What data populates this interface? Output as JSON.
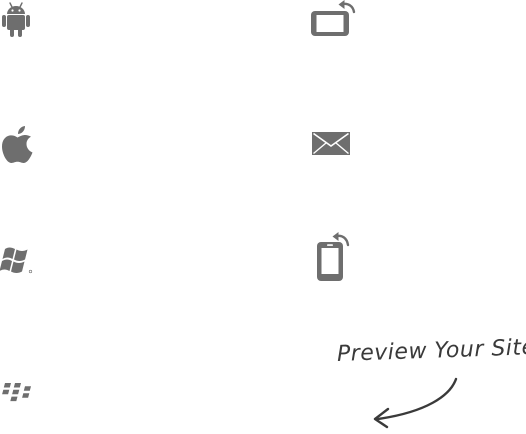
{
  "devices": {
    "android": {
      "icon": "android-icon"
    },
    "apple": {
      "icon": "apple-icon"
    },
    "windows": {
      "icon": "windows-icon"
    },
    "blackberry": {
      "icon": "blackberry-icon"
    }
  },
  "actions": {
    "rotate_tablet": {
      "icon": "rotate-tablet-icon"
    },
    "email": {
      "icon": "envelope-icon"
    },
    "rotate_phone": {
      "icon": "rotate-phone-icon"
    }
  },
  "preview": {
    "label": "Preview Your Site",
    "arrow_icon": "curved-arrow-icon"
  },
  "colors": {
    "icon": "#6e6e6e",
    "background": "#ffffff",
    "handwriting": "#3a3a3a"
  }
}
